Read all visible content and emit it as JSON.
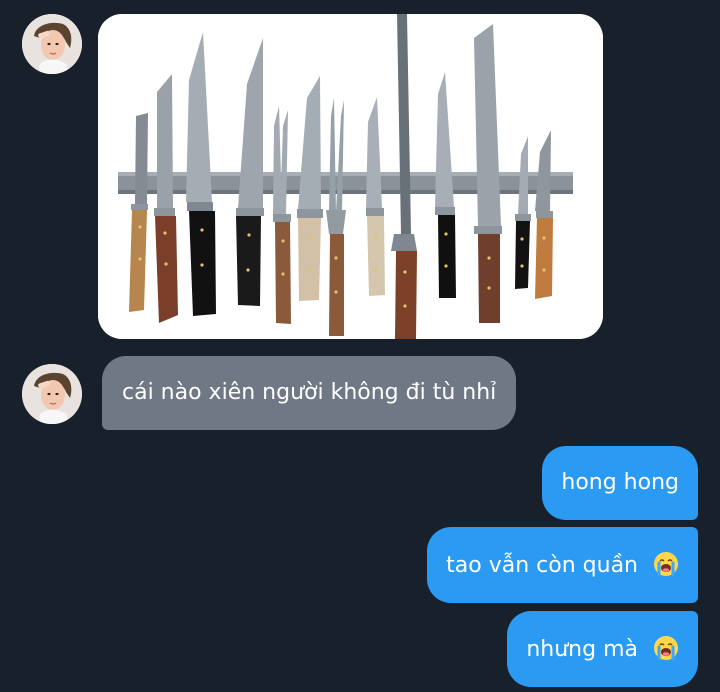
{
  "conversation": {
    "messages": [
      {
        "sender": "other",
        "type": "image",
        "image_subject": "knives on a magnetic rack"
      },
      {
        "sender": "other",
        "type": "text",
        "text": "cái nào xiên người không đi tù nhỉ"
      },
      {
        "sender": "me",
        "type": "text",
        "text": "hong hong"
      },
      {
        "sender": "me",
        "type": "text",
        "text": "tao vẫn còn quần",
        "emoji": "loudly-crying-face"
      },
      {
        "sender": "me",
        "type": "text",
        "text": "nhưng mà",
        "emoji": "loudly-crying-face"
      }
    ]
  },
  "colors": {
    "background": "#17202b",
    "incoming_bubble": "#6f7884",
    "outgoing_bubble": "#2b9af3",
    "text": "#ffffff"
  }
}
